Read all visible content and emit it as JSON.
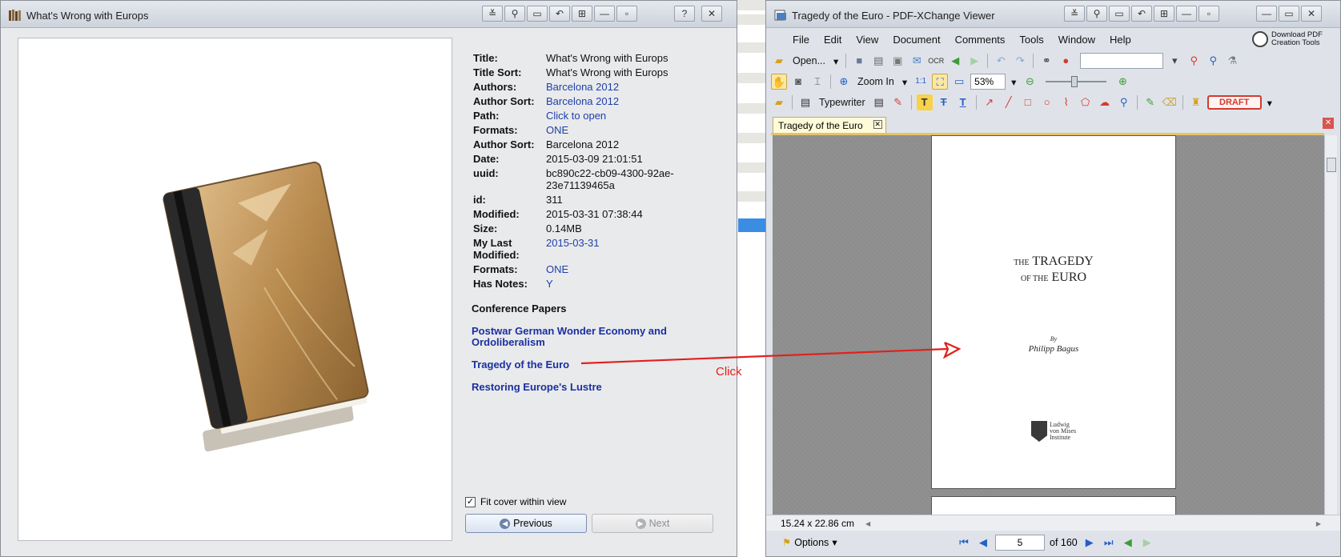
{
  "left_window": {
    "title": "What's Wrong with Europs",
    "title_buttons": [
      "≚",
      "⚲",
      "▭",
      "↶",
      "⊞",
      "—",
      "▫",
      "?",
      "✕"
    ],
    "metadata": [
      {
        "key": "Title:",
        "value": "What's Wrong with Europs",
        "link": false
      },
      {
        "key": "Title Sort:",
        "value": "What's Wrong with Europs",
        "link": false
      },
      {
        "key": "Authors:",
        "value": "Barcelona 2012",
        "link": true
      },
      {
        "key": "Author Sort:",
        "value": "Barcelona 2012",
        "link": true
      },
      {
        "key": "Path:",
        "value": "Click to open",
        "link": true
      },
      {
        "key": "Formats:",
        "value": "ONE",
        "link": true
      },
      {
        "key": "Author Sort:",
        "value": "Barcelona 2012",
        "link": false
      },
      {
        "key": "Date:",
        "value": "2015-03-09 21:01:51",
        "link": false
      },
      {
        "key": "uuid:",
        "value": "bc890c22-cb09-4300-92ae-23e71139465a",
        "link": false
      },
      {
        "key": "id:",
        "value": "311",
        "link": false
      },
      {
        "key": "Modified:",
        "value": "2015-03-31 07:38:44",
        "link": false
      },
      {
        "key": "Size:",
        "value": "0.14MB",
        "link": false
      },
      {
        "key": "My Last Modified:",
        "value": "2015-03-31",
        "link": true
      },
      {
        "key": "Formats:",
        "value": "ONE",
        "link": true
      },
      {
        "key": "Has Notes:",
        "value": "Y",
        "link": true
      }
    ],
    "section_heading": "Conference Papers",
    "conference_links": [
      "Postwar German Wonder Economy and Ordoliberalism",
      "Tragedy of the Euro",
      "Restoring Europe's Lustre"
    ],
    "fit_cover_label": "Fit cover within view",
    "fit_cover_checked": true,
    "previous_label": "Previous",
    "next_label": "Next"
  },
  "annotation": {
    "label": "Click",
    "color": "#e0201c"
  },
  "right_window": {
    "title": "Tragedy of the Euro - PDF-XChange Viewer",
    "menu": [
      "File",
      "Edit",
      "View",
      "Document",
      "Comments",
      "Tools",
      "Window",
      "Help"
    ],
    "download_badge": [
      "Download PDF",
      "Creation Tools"
    ],
    "toolbar": {
      "open_label": "Open...",
      "zoom_in_label": "Zoom In",
      "zoom_value": "53%",
      "typewriter_label": "Typewriter",
      "draft_label": "DRAFT"
    },
    "doc_tab": "Tragedy of the Euro",
    "page_content": {
      "title_prefix_1": "THE",
      "title_word_1": "TRAGEDY",
      "title_prefix_2": "OF THE",
      "title_word_2": "EURO",
      "by": "By",
      "author": "Philipp Bagus",
      "logo_lines": [
        "Ludwig",
        "von Mises",
        "Institute"
      ]
    },
    "status": {
      "page_size": "15.24 x 22.86 cm",
      "options_label": "Options",
      "current_page": "5",
      "total_pages": "of 160"
    }
  }
}
